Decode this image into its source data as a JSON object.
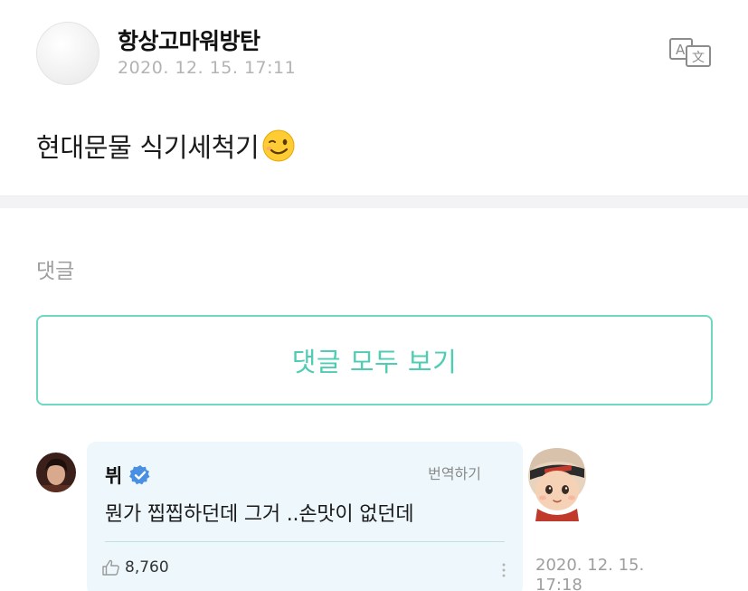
{
  "post": {
    "author": "항상고마워방탄",
    "date": "2020. 12. 15. 17:11",
    "body": "현대문물 식기세척기",
    "emoji_icon": "winking-face-icon"
  },
  "comments": {
    "section_title": "댓글",
    "view_all_label": "댓글 모두 보기",
    "items": [
      {
        "author": "뷔",
        "verified": true,
        "translate_label": "번역하기",
        "text": "뭔가 찝찝하던데 그거 ..손맛이 없던데",
        "likes": "8,760",
        "date": "2020. 12. 15.",
        "time": "17:18"
      }
    ]
  },
  "colors": {
    "accent": "#4fcdb3",
    "bubble_bg": "#eef8fc",
    "verified": "#4a90e2",
    "muted_text": "#b3b3b3"
  }
}
